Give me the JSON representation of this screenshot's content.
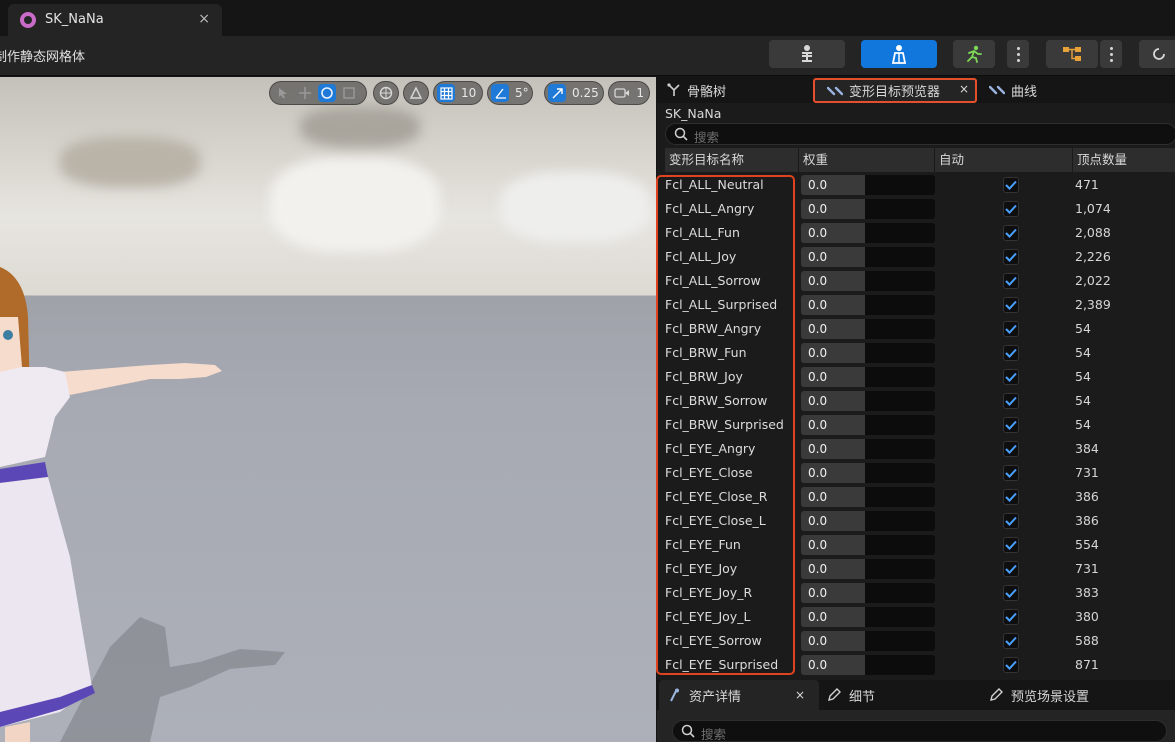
{
  "document_tab": {
    "title": "SK_NaNa",
    "close": "×"
  },
  "toolbar": {
    "label": "制作静态网格体",
    "mode_buttons": [
      "skeleton-mode",
      "mesh-mode",
      "animation-mode",
      "blueprint-mode"
    ]
  },
  "viewport": {
    "toolbar": {
      "grid_snap": "10",
      "rotation_snap": "5°",
      "scale_snap": "0.25",
      "camera_speed": "1"
    }
  },
  "panel_tabs": {
    "skeleton_tree": "骨骼树",
    "morph_preview": "变形目标预览器",
    "curves": "曲线",
    "close": "×"
  },
  "asset_name": "SK_NaNa",
  "search": {
    "placeholder": "搜索"
  },
  "table": {
    "headers": {
      "name": "变形目标名称",
      "weight": "权重",
      "auto": "自动",
      "vertex_count": "顶点数量"
    },
    "rows": [
      {
        "name": "Fcl_ALL_Neutral",
        "weight": "0.0",
        "auto": true,
        "vertex_count": "471"
      },
      {
        "name": "Fcl_ALL_Angry",
        "weight": "0.0",
        "auto": true,
        "vertex_count": "1,074"
      },
      {
        "name": "Fcl_ALL_Fun",
        "weight": "0.0",
        "auto": true,
        "vertex_count": "2,088"
      },
      {
        "name": "Fcl_ALL_Joy",
        "weight": "0.0",
        "auto": true,
        "vertex_count": "2,226"
      },
      {
        "name": "Fcl_ALL_Sorrow",
        "weight": "0.0",
        "auto": true,
        "vertex_count": "2,022"
      },
      {
        "name": "Fcl_ALL_Surprised",
        "weight": "0.0",
        "auto": true,
        "vertex_count": "2,389"
      },
      {
        "name": "Fcl_BRW_Angry",
        "weight": "0.0",
        "auto": true,
        "vertex_count": "54"
      },
      {
        "name": "Fcl_BRW_Fun",
        "weight": "0.0",
        "auto": true,
        "vertex_count": "54"
      },
      {
        "name": "Fcl_BRW_Joy",
        "weight": "0.0",
        "auto": true,
        "vertex_count": "54"
      },
      {
        "name": "Fcl_BRW_Sorrow",
        "weight": "0.0",
        "auto": true,
        "vertex_count": "54"
      },
      {
        "name": "Fcl_BRW_Surprised",
        "weight": "0.0",
        "auto": true,
        "vertex_count": "54"
      },
      {
        "name": "Fcl_EYE_Angry",
        "weight": "0.0",
        "auto": true,
        "vertex_count": "384"
      },
      {
        "name": "Fcl_EYE_Close",
        "weight": "0.0",
        "auto": true,
        "vertex_count": "731"
      },
      {
        "name": "Fcl_EYE_Close_R",
        "weight": "0.0",
        "auto": true,
        "vertex_count": "386"
      },
      {
        "name": "Fcl_EYE_Close_L",
        "weight": "0.0",
        "auto": true,
        "vertex_count": "386"
      },
      {
        "name": "Fcl_EYE_Fun",
        "weight": "0.0",
        "auto": true,
        "vertex_count": "554"
      },
      {
        "name": "Fcl_EYE_Joy",
        "weight": "0.0",
        "auto": true,
        "vertex_count": "731"
      },
      {
        "name": "Fcl_EYE_Joy_R",
        "weight": "0.0",
        "auto": true,
        "vertex_count": "383"
      },
      {
        "name": "Fcl_EYE_Joy_L",
        "weight": "0.0",
        "auto": true,
        "vertex_count": "380"
      },
      {
        "name": "Fcl_EYE_Sorrow",
        "weight": "0.0",
        "auto": true,
        "vertex_count": "588"
      },
      {
        "name": "Fcl_EYE_Surprised",
        "weight": "0.0",
        "auto": true,
        "vertex_count": "871"
      }
    ]
  },
  "bottom_tabs": {
    "asset_details": "资产详情",
    "details": "细节",
    "preview_scene": "预览场景设置",
    "close": "×"
  },
  "bottom_search": {
    "placeholder": "搜索"
  },
  "colors": {
    "accent": "#1177dd",
    "highlight_border": "#e0431f",
    "panel_bg": "#1b1b1b"
  }
}
